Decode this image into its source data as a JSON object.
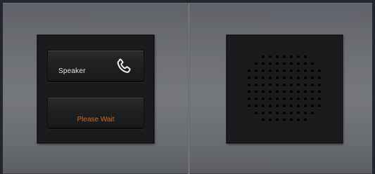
{
  "panel": {
    "speaker_key": {
      "label": "Speaker",
      "icon": "phone-handset-icon"
    },
    "status_key": {
      "label": "Please Wait",
      "color": "#d46a1e"
    },
    "speaker_grille": {
      "icon": "speaker-grille"
    }
  },
  "colors": {
    "plate": "#6d7075",
    "module": "#1a1b1d",
    "label": "#e8e8e8",
    "status": "#d46a1e"
  }
}
